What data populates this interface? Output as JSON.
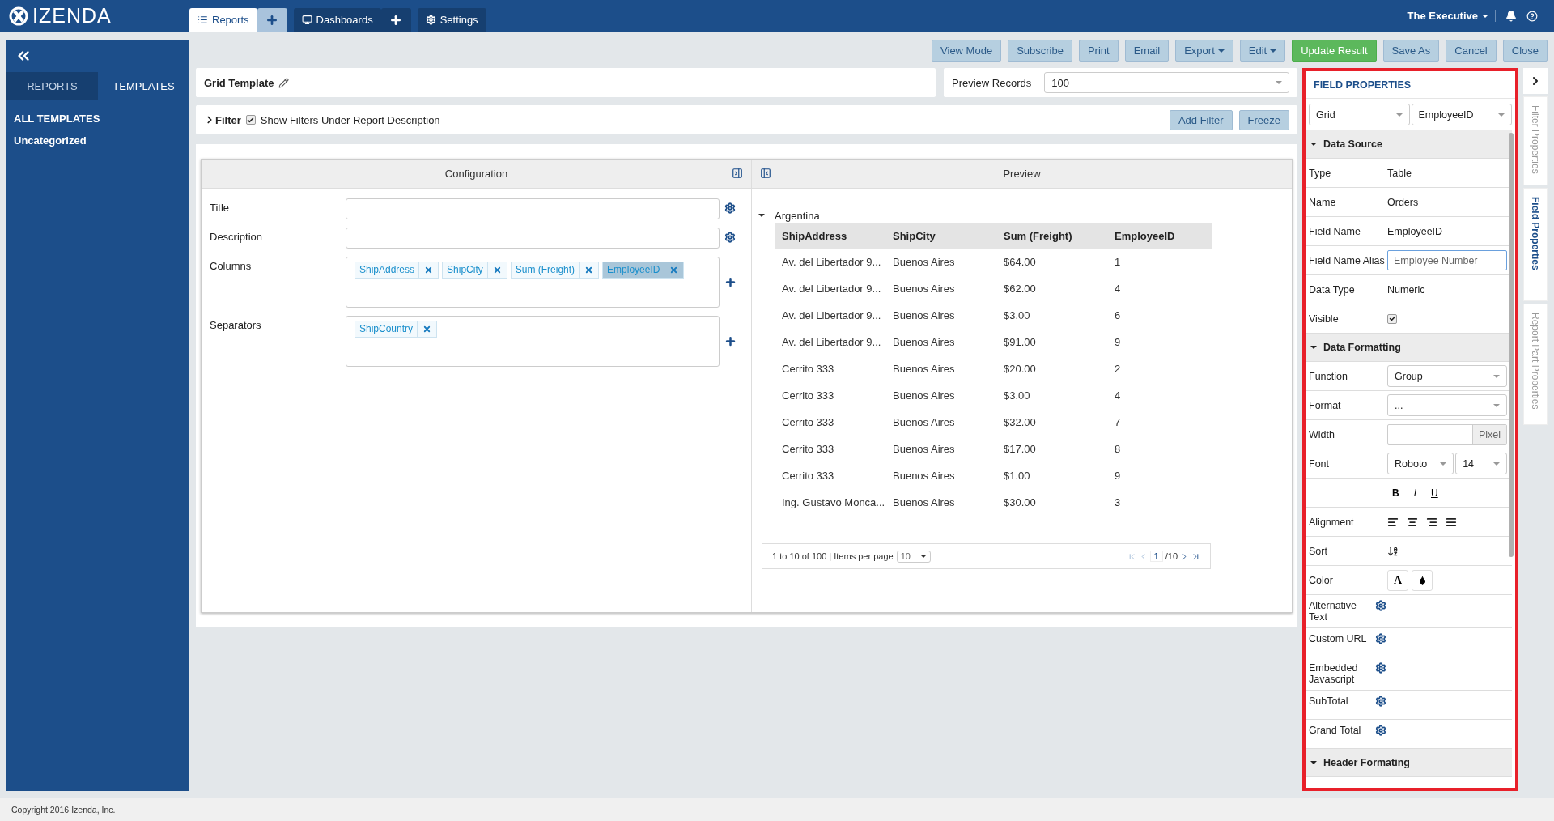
{
  "brand": {
    "name": "IZENDA"
  },
  "nav": {
    "tabs": [
      {
        "kind": "tab",
        "label": "Reports",
        "selected": true
      },
      {
        "kind": "add"
      },
      {
        "kind": "tab",
        "label": "Dashboards",
        "selected": false
      },
      {
        "kind": "add"
      },
      {
        "kind": "tab",
        "label": "Settings",
        "selected": false
      }
    ]
  },
  "user": {
    "name": "The Executive"
  },
  "sidebar": {
    "tabs": [
      {
        "label": "REPORTS",
        "selected": false
      },
      {
        "label": "TEMPLATES",
        "selected": true
      }
    ],
    "items": [
      {
        "label": "ALL TEMPLATES",
        "kind": "heading"
      },
      {
        "label": "Uncategorized",
        "kind": "category"
      }
    ]
  },
  "toolbar": {
    "buttons": [
      {
        "label": "View Mode",
        "kind": "plain"
      },
      {
        "label": "Subscribe",
        "kind": "plain"
      },
      {
        "label": "Print",
        "kind": "plain"
      },
      {
        "label": "Email",
        "kind": "plain"
      },
      {
        "label": "Export",
        "kind": "dropdown"
      },
      {
        "label": "Edit",
        "kind": "dropdown"
      },
      {
        "label": "Update Result",
        "kind": "primary"
      },
      {
        "label": "Save As",
        "kind": "plain"
      },
      {
        "label": "Cancel",
        "kind": "plain"
      },
      {
        "label": "Close",
        "kind": "plain"
      }
    ]
  },
  "report": {
    "title": "Grid Template",
    "preview_records": {
      "label": "Preview Records",
      "value": "100"
    }
  },
  "filter": {
    "label": "Filter",
    "option": {
      "label": "Show Filters Under Report Description",
      "checked": true
    },
    "buttons": [
      "Add Filter",
      "Freeze"
    ]
  },
  "configuration": {
    "title": "Configuration",
    "fields": [
      {
        "label": "Title",
        "kind": "text"
      },
      {
        "label": "Description",
        "kind": "text"
      },
      {
        "label": "Columns",
        "kind": "tags",
        "tags": [
          {
            "label": "ShipAddress",
            "selected": false
          },
          {
            "label": "ShipCity",
            "selected": false
          },
          {
            "label": "Sum (Freight)",
            "selected": false
          },
          {
            "label": "EmployeeID",
            "selected": true
          }
        ]
      },
      {
        "label": "Separators",
        "kind": "tags",
        "tags": [
          {
            "label": "ShipCountry",
            "selected": false
          }
        ]
      }
    ]
  },
  "preview": {
    "title": "Preview",
    "group": {
      "label": "Argentina",
      "expanded": true
    },
    "columns": [
      "ShipAddress",
      "ShipCity",
      "Sum (Freight)",
      "EmployeeID"
    ],
    "rows": [
      [
        "Av. del Libertador 9...",
        "Buenos Aires",
        "$64.00",
        "1"
      ],
      [
        "Av. del Libertador 9...",
        "Buenos Aires",
        "$62.00",
        "4"
      ],
      [
        "Av. del Libertador 9...",
        "Buenos Aires",
        "$3.00",
        "6"
      ],
      [
        "Av. del Libertador 9...",
        "Buenos Aires",
        "$91.00",
        "9"
      ],
      [
        "Cerrito 333",
        "Buenos Aires",
        "$20.00",
        "2"
      ],
      [
        "Cerrito 333",
        "Buenos Aires",
        "$3.00",
        "4"
      ],
      [
        "Cerrito 333",
        "Buenos Aires",
        "$32.00",
        "7"
      ],
      [
        "Cerrito 333",
        "Buenos Aires",
        "$17.00",
        "8"
      ],
      [
        "Cerrito 333",
        "Buenos Aires",
        "$1.00",
        "9"
      ],
      [
        "Ing. Gustavo Monca...",
        "Buenos Aires",
        "$30.00",
        "3"
      ]
    ],
    "pager": {
      "summary": "1 to 10 of 100 | Items per page",
      "per_page": "10",
      "page": "1",
      "total": "/10"
    }
  },
  "field_properties": {
    "title": "FIELD PROPERTIES",
    "selects": [
      "Grid",
      "EmployeeID"
    ],
    "sections": [
      {
        "title": "Data Source",
        "expanded": true,
        "rows": [
          {
            "kind": "text",
            "label": "Type",
            "value": "Table"
          },
          {
            "kind": "text",
            "label": "Name",
            "value": "Orders"
          },
          {
            "kind": "text",
            "label": "Field Name",
            "value": "EmployeeID"
          },
          {
            "kind": "input",
            "label": "Field Name Alias",
            "placeholder": "Employee Number"
          },
          {
            "kind": "text",
            "label": "Data Type",
            "value": "Numeric"
          },
          {
            "kind": "checkbox",
            "label": "Visible",
            "checked": true
          }
        ]
      },
      {
        "title": "Data Formatting",
        "expanded": true,
        "rows": [
          {
            "kind": "select",
            "label": "Function",
            "value": "Group"
          },
          {
            "kind": "select",
            "label": "Format",
            "value": "..."
          },
          {
            "kind": "unit",
            "label": "Width",
            "unit": "Pixel"
          },
          {
            "kind": "font",
            "label": "Font",
            "family": "Roboto",
            "size": "14"
          },
          {
            "kind": "styles",
            "items": [
              {
                "kind": "bold",
                "label": "B"
              },
              {
                "kind": "italic",
                "label": "I"
              },
              {
                "kind": "underline",
                "label": "U"
              }
            ]
          },
          {
            "kind": "align",
            "label": "Alignment"
          },
          {
            "kind": "sort",
            "label": "Sort"
          },
          {
            "kind": "color",
            "label": "Color",
            "text": "A"
          },
          {
            "kind": "gear",
            "label": "Alternative Text"
          },
          {
            "kind": "gear",
            "label": "Custom URL"
          },
          {
            "kind": "gear",
            "label": "Embedded Javascript"
          },
          {
            "kind": "gear",
            "label": "SubTotal"
          },
          {
            "kind": "gear",
            "label": "Grand Total"
          }
        ]
      },
      {
        "title": "Header Formating",
        "expanded": true
      }
    ]
  },
  "side_tabs": [
    {
      "label": "Filter Properties",
      "selected": false
    },
    {
      "label": "Field Properties",
      "selected": true
    },
    {
      "label": "Report Part Properties",
      "selected": false
    }
  ],
  "footer": {
    "text": "Copyright 2016 Izenda, Inc."
  }
}
